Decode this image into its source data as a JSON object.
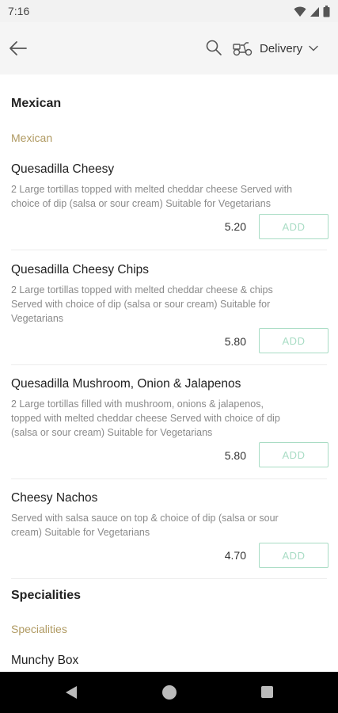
{
  "status_bar": {
    "time": "7:16"
  },
  "header": {
    "delivery_label": "Delivery"
  },
  "sections": [
    {
      "category": "Mexican",
      "subcategory": "Mexican",
      "items": [
        {
          "name": "Quesadilla Cheesy",
          "desc_lines": [
            "2 Large tortillas topped with melted cheddar cheese  Served with",
            "choice of dip (salsa or sour cream)   Suitable for Vegetarians"
          ],
          "price": "5.20",
          "add_label": "ADD"
        },
        {
          "name": "Quesadilla Cheesy Chips",
          "desc_lines": [
            "2 Large tortillas topped with melted cheddar cheese & chips",
            "Served with choice of dip (salsa or sour cream)   Suitable for",
            "Vegetarians"
          ],
          "price": "5.80",
          "add_label": "ADD"
        },
        {
          "name": "Quesadilla Mushroom, Onion & Jalapenos",
          "desc_lines": [
            "2 Large tortillas filled with mushroom, onions & jalapenos,",
            "topped with melted cheddar cheese  Served with choice of dip",
            "(salsa or sour cream)   Suitable for Vegetarians"
          ],
          "price": "5.80",
          "add_label": "ADD"
        },
        {
          "name": "Cheesy Nachos",
          "desc_lines": [
            "Served with salsa sauce on top & choice of dip (salsa or sour",
            "cream)   Suitable for Vegetarians"
          ],
          "price": "4.70",
          "add_label": "ADD"
        }
      ]
    },
    {
      "category": "Specialities",
      "subcategory": "Specialities",
      "items": [
        {
          "name": "Munchy Box"
        }
      ]
    }
  ],
  "colors": {
    "accent_gold": "#b09a62",
    "add_border": "#a8dcc4",
    "nav_bar": "#000000"
  }
}
